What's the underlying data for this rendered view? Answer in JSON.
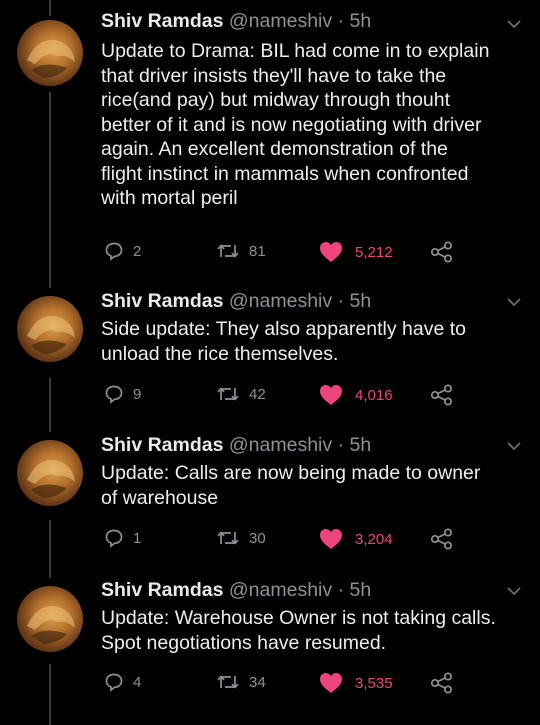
{
  "colors": {
    "background": "#000000",
    "like": "#f0447c",
    "muted": "#8b9196"
  },
  "tweets": [
    {
      "author": "Shiv Ramdas",
      "handle": "@nameshiv",
      "separator": "·",
      "time": "5h",
      "lines": [
        "Update to Drama: BIL had come in to explain",
        "that driver insists they'll have to take the",
        "rice(and pay) but midway through thouht",
        "better of it and is now negotiating with driver",
        "again. An excellent demonstration of the",
        "flight instinct in mammals when confronted",
        "with mortal peril"
      ],
      "replies": "2",
      "retweets": "81",
      "likes": "5,212"
    },
    {
      "author": "Shiv Ramdas",
      "handle": "@nameshiv",
      "separator": "·",
      "time": "5h",
      "lines": [
        "Side update: They also apparently have to",
        "unload the rice themselves."
      ],
      "replies": "9",
      "retweets": "42",
      "likes": "4,016"
    },
    {
      "author": "Shiv Ramdas",
      "handle": "@nameshiv",
      "separator": "·",
      "time": "5h",
      "lines": [
        "Update: Calls are now being made to owner",
        "of warehouse"
      ],
      "replies": "1",
      "retweets": "30",
      "likes": "3,204"
    },
    {
      "author": "Shiv Ramdas",
      "handle": "@nameshiv",
      "separator": "·",
      "time": "5h",
      "lines": [
        "Update: Warehouse Owner is not taking calls.",
        "Spot negotiations have resumed."
      ],
      "replies": "4",
      "retweets": "34",
      "likes": "3,535"
    }
  ]
}
